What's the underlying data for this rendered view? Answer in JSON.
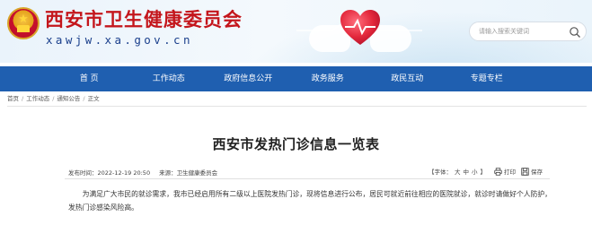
{
  "header": {
    "title": "西安市卫生健康委员会",
    "domain": "xawjw.xa.gov.cn",
    "search_placeholder": "请输入搜索关键词"
  },
  "nav": {
    "items": [
      "首 页",
      "工作动态",
      "政府信息公开",
      "政务服务",
      "政民互动",
      "专题专栏"
    ]
  },
  "breadcrumb": [
    "首页",
    "工作动态",
    "通知公告",
    "正文"
  ],
  "article": {
    "title": "西安市发热门诊信息一览表",
    "publish_time": "发布时间：2022-12-19 20:50",
    "source": "来源：卫生健康委员会",
    "font_label": "【字体：",
    "font_sizes": [
      "大",
      "中",
      "小"
    ],
    "font_close": "】",
    "print_label": "打印",
    "save_label": "保存",
    "paragraph": "为满足广大市民的就诊需求，我市已经启用所有二级以上医院发热门诊，现将信息进行公布，居民可就近前往相应的医院就诊，就诊时请做好个人防护，发热门诊感染风险高。"
  },
  "colors": {
    "brand_red": "#c4161c",
    "nav_blue": "#1f5fb0",
    "domain_blue": "#1a3f8c"
  },
  "icons": [
    "national-emblem-icon",
    "heart-hands-icon",
    "search-icon",
    "print-icon",
    "save-icon"
  ]
}
